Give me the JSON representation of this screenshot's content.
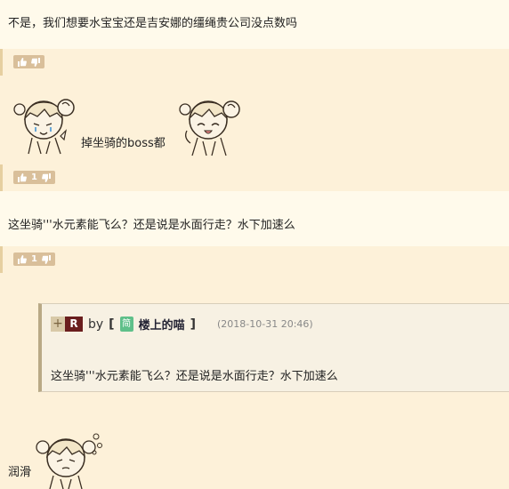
{
  "posts": [
    {
      "text": "不是，我们想要水宝宝还是吉安娜的缰绳贵公司没点数吗"
    },
    {
      "inline_text": "掉坐骑的boss都",
      "vote_count": "1"
    },
    {
      "text": "这坐骑'''水元素能飞么？还是说是水面行走？水下加速么",
      "vote_count": "1"
    },
    {
      "last_text": "润滑"
    }
  ],
  "vote_bar": {
    "up_icon": "thumbs-up-icon",
    "down_icon": "thumbs-down-icon"
  },
  "quote": {
    "plus": "+",
    "badge": "R",
    "by_label": "by",
    "bracket_open": "[",
    "bracket_close": "]",
    "level_icon": "简",
    "username": "楼上的喵",
    "date": "(2018-10-31 20:46)",
    "body": "这坐骑'''水元素能飞么？还是说是水面行走？水下加速么"
  },
  "colors": {
    "background": "#fffaeb",
    "vote_strip": "#fdf1d9",
    "vote_button": "#d9bf9a",
    "badge": "#6a1e1e"
  }
}
